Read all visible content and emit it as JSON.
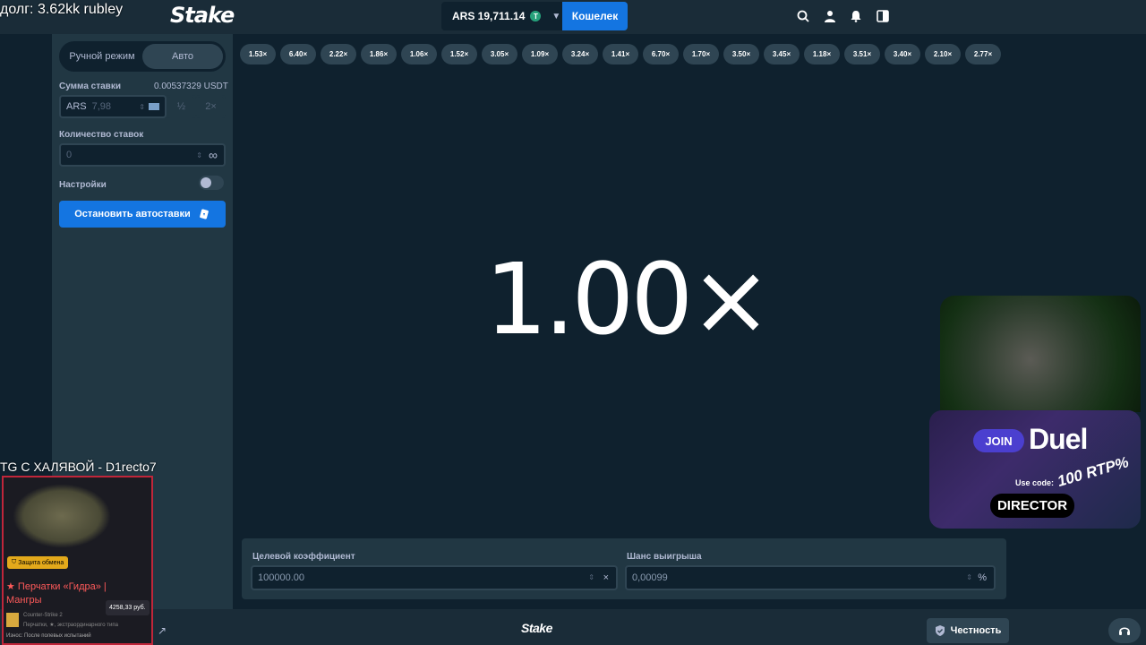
{
  "stream": {
    "debt_text": "долг: 3.62kk rubley",
    "tg_text": "TG С ХАЛЯВОЙ - D1recto7"
  },
  "header": {
    "logo": "Stake",
    "balance": "ARS 19,711.14",
    "coin_icon": "tether-icon",
    "wallet_label": "Кошелек",
    "icons": [
      "search-icon",
      "user-icon",
      "bell-icon",
      "sidebar-toggle-icon"
    ]
  },
  "sidebar": {
    "mode_manual": "Ручной режим",
    "mode_auto": "Авто",
    "bet_label": "Сумма ставки",
    "bet_usdt": "0.00537329 USDT",
    "bet_currency": "ARS",
    "bet_value": "7,98",
    "half": "½",
    "double": "2×",
    "count_label": "Количество ставок",
    "count_value": "0",
    "infinity": "∞",
    "settings_label": "Настройки",
    "stop_button": "Остановить автоставки"
  },
  "history": [
    "1.53×",
    "6.40×",
    "2.22×",
    "1.86×",
    "1.06×",
    "1.52×",
    "3.05×",
    "1.09×",
    "3.24×",
    "1.41×",
    "6.70×",
    "1.70×",
    "3.50×",
    "3.45×",
    "1.18×",
    "3.51×",
    "3.40×",
    "2.10×",
    "2.77×"
  ],
  "game": {
    "multiplier": "1.00×"
  },
  "bottom": {
    "target_label": "Целевой коэффициент",
    "target_value": "100000.00",
    "target_suffix": "×",
    "chance_label": "Шанс выигрыша",
    "chance_value": "0,00099",
    "chance_suffix": "%"
  },
  "footer": {
    "logo": "Stake",
    "fairness": "Честность"
  },
  "promo": {
    "badge": "Защита обмена",
    "item_name": "★ Перчатки «Гидра» | Мангры",
    "price": "4258,33 руб.",
    "game": "Counter-Strike 2",
    "type": "Перчатки, ★, экстраординарного типа",
    "wear": "Износ: После полевых испытаний"
  },
  "duel_ad": {
    "join": "JOIN",
    "brand": "Duel",
    "rtp": "100 RTP%",
    "use_code": "Use code:",
    "code": "DIRECTOR"
  }
}
